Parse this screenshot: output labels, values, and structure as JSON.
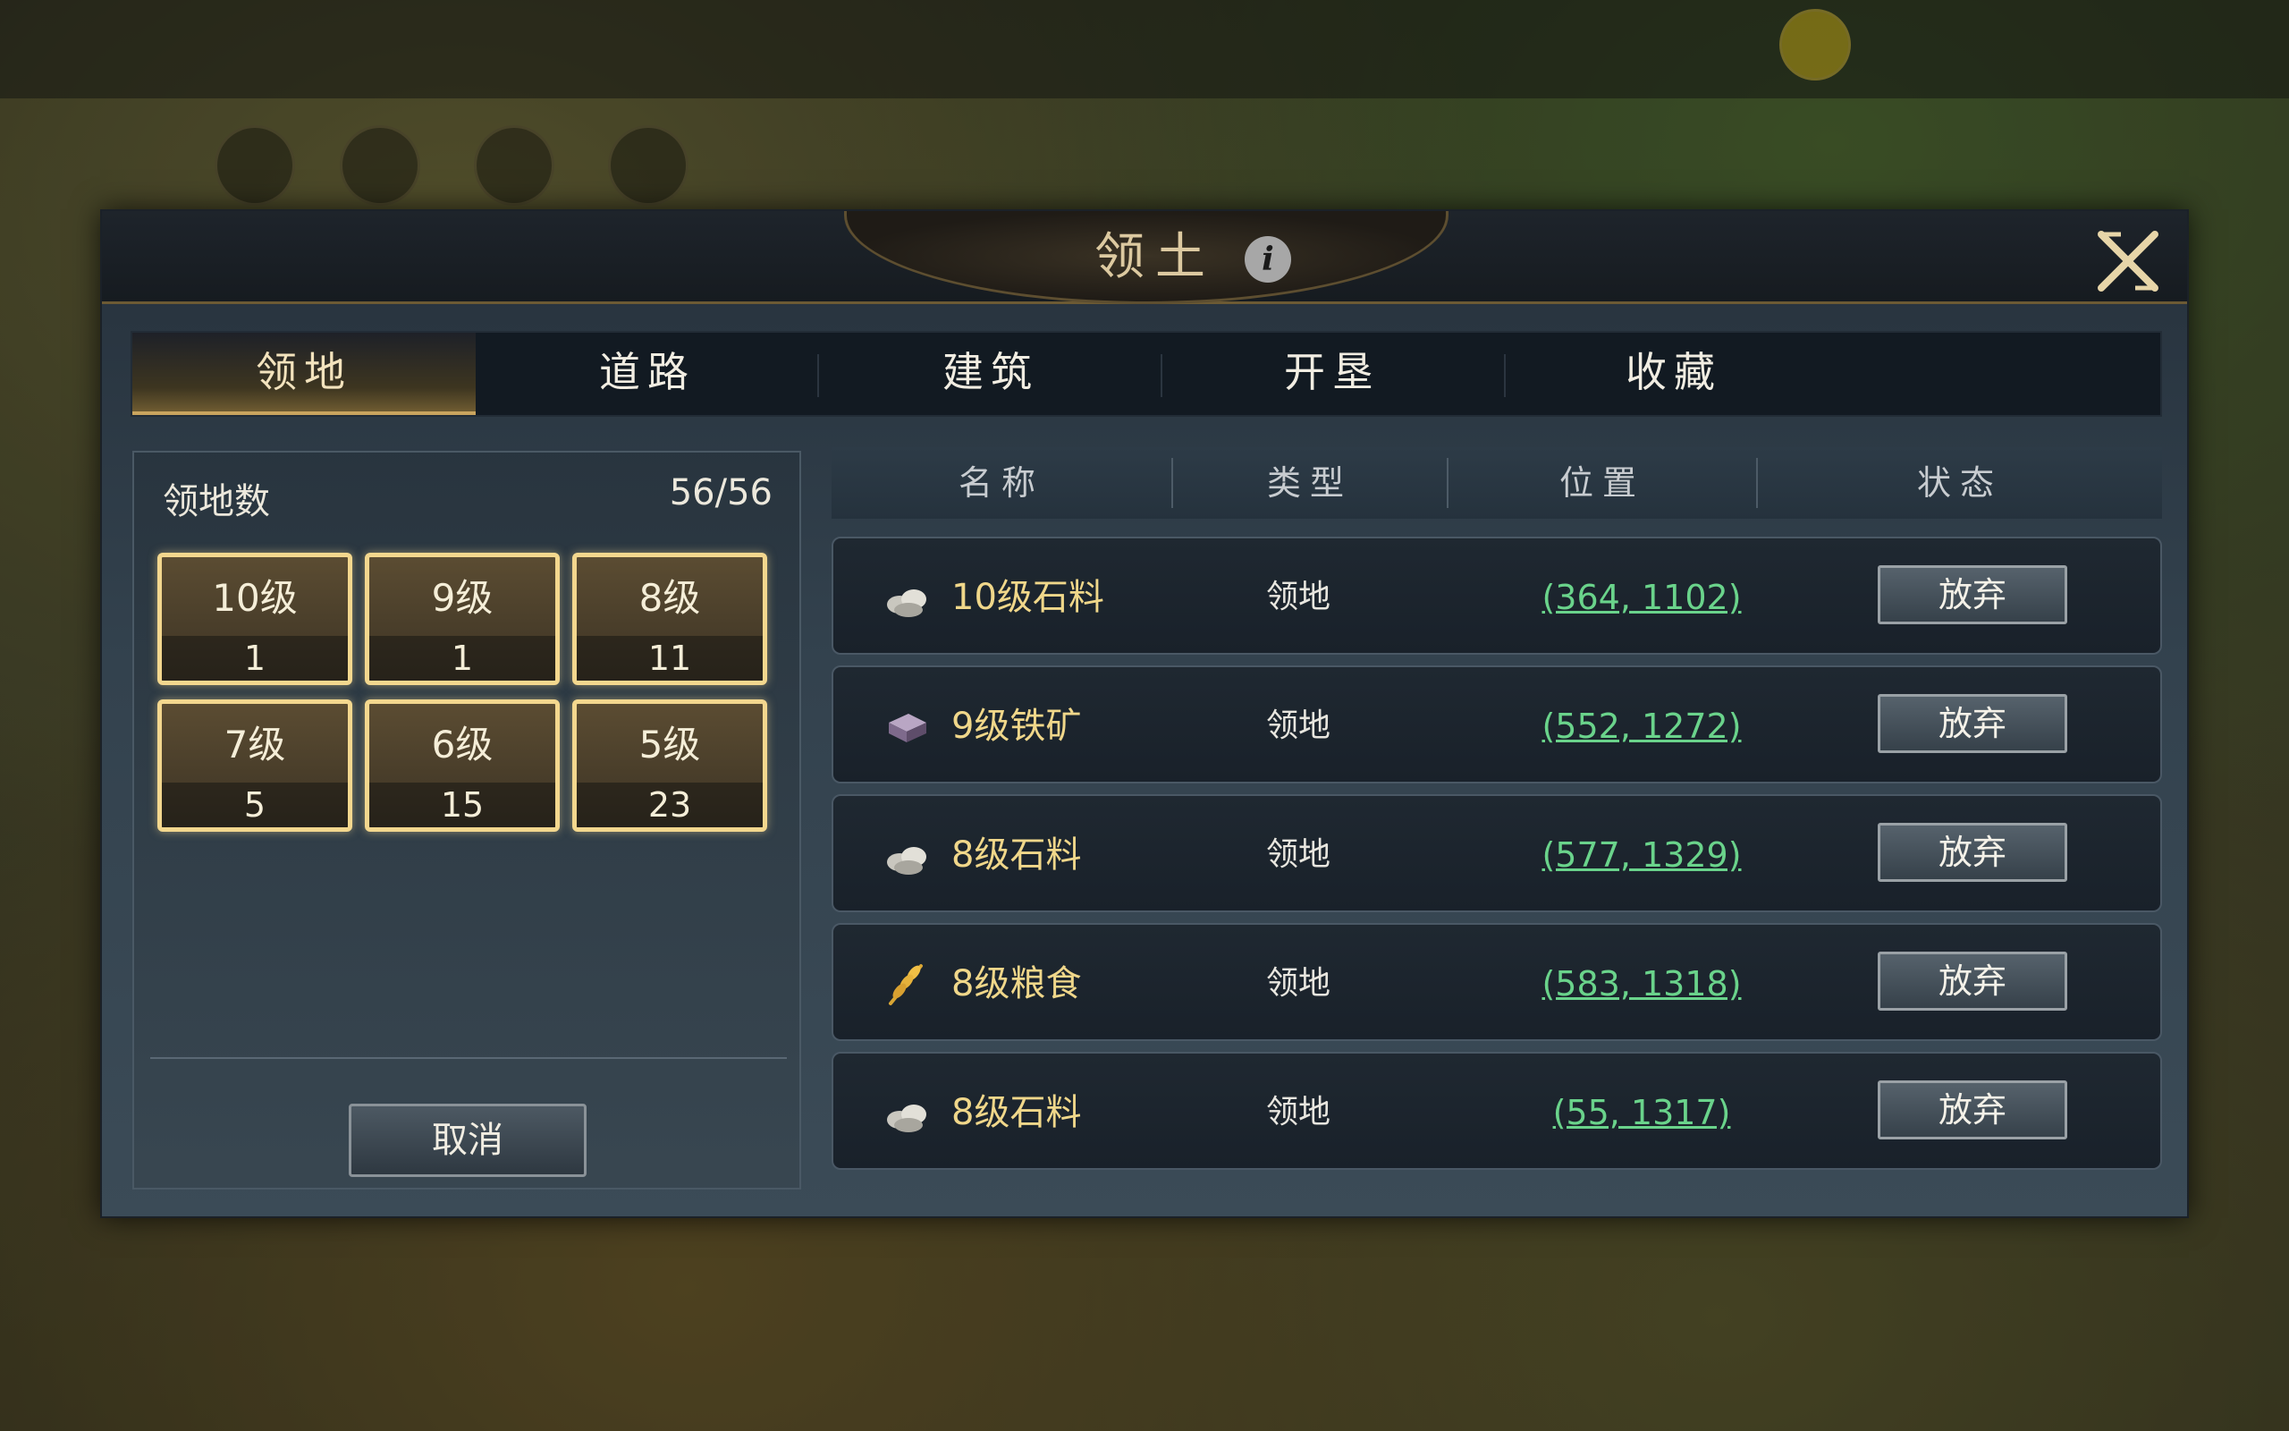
{
  "dialog": {
    "title": "领土",
    "tabs": [
      {
        "label": "领地",
        "active": true
      },
      {
        "label": "道路",
        "active": false
      },
      {
        "label": "建筑",
        "active": false
      },
      {
        "label": "开垦",
        "active": false
      },
      {
        "label": "收藏",
        "active": false
      }
    ]
  },
  "summary": {
    "label": "领地数",
    "count": "56/56",
    "levels": [
      {
        "name": "10级",
        "value": "1"
      },
      {
        "name": "9级",
        "value": "1"
      },
      {
        "name": "8级",
        "value": "11"
      },
      {
        "name": "7级",
        "value": "5"
      },
      {
        "name": "6级",
        "value": "15"
      },
      {
        "name": "5级",
        "value": "23"
      }
    ],
    "cancel_label": "取消"
  },
  "table": {
    "headers": [
      "名称",
      "类型",
      "位置",
      "状态"
    ],
    "rows": [
      {
        "icon": "stone-icon",
        "name": "10级石料",
        "type": "领地",
        "position": "(364, 1102)",
        "action": "放弃"
      },
      {
        "icon": "iron-ore-icon",
        "name": "9级铁矿",
        "type": "领地",
        "position": "(552, 1272)",
        "action": "放弃"
      },
      {
        "icon": "stone-icon",
        "name": "8级石料",
        "type": "领地",
        "position": "(577, 1329)",
        "action": "放弃"
      },
      {
        "icon": "grain-icon",
        "name": "8级粮食",
        "type": "领地",
        "position": "(583, 1318)",
        "action": "放弃"
      },
      {
        "icon": "stone-icon",
        "name": "8级石料",
        "type": "领地",
        "position": "(55, 1317)",
        "action": "放弃"
      }
    ]
  },
  "colors": {
    "accent_gold": "#f3d78e",
    "coordinate_green": "#6ad38b",
    "name_gold": "#f0d78a"
  }
}
